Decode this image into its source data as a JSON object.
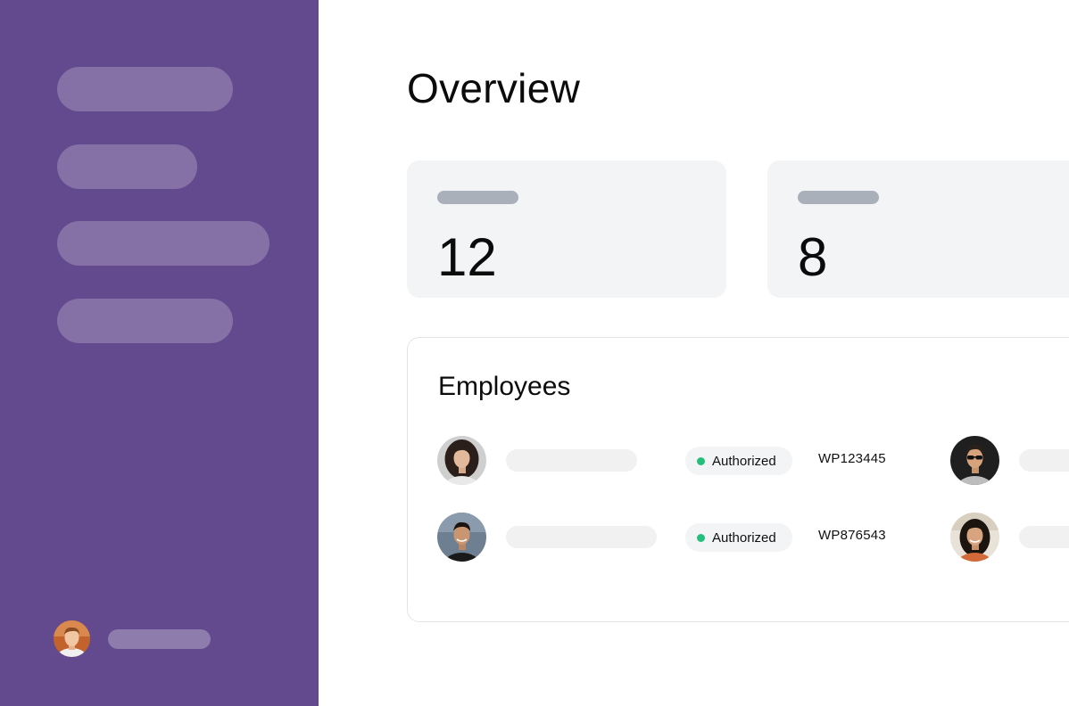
{
  "main": {
    "title": "Overview",
    "stats": [
      {
        "value": "12"
      },
      {
        "value": "8"
      }
    ],
    "employees": {
      "title": "Employees",
      "rows": [
        {
          "status": "Authorized",
          "id": "WP123445"
        },
        {
          "status": "Authorized",
          "id": "WP876543"
        }
      ]
    }
  },
  "colors": {
    "sidebar": "#634a8e",
    "card_bg": "#f3f4f6",
    "status_green": "#22c07a"
  }
}
